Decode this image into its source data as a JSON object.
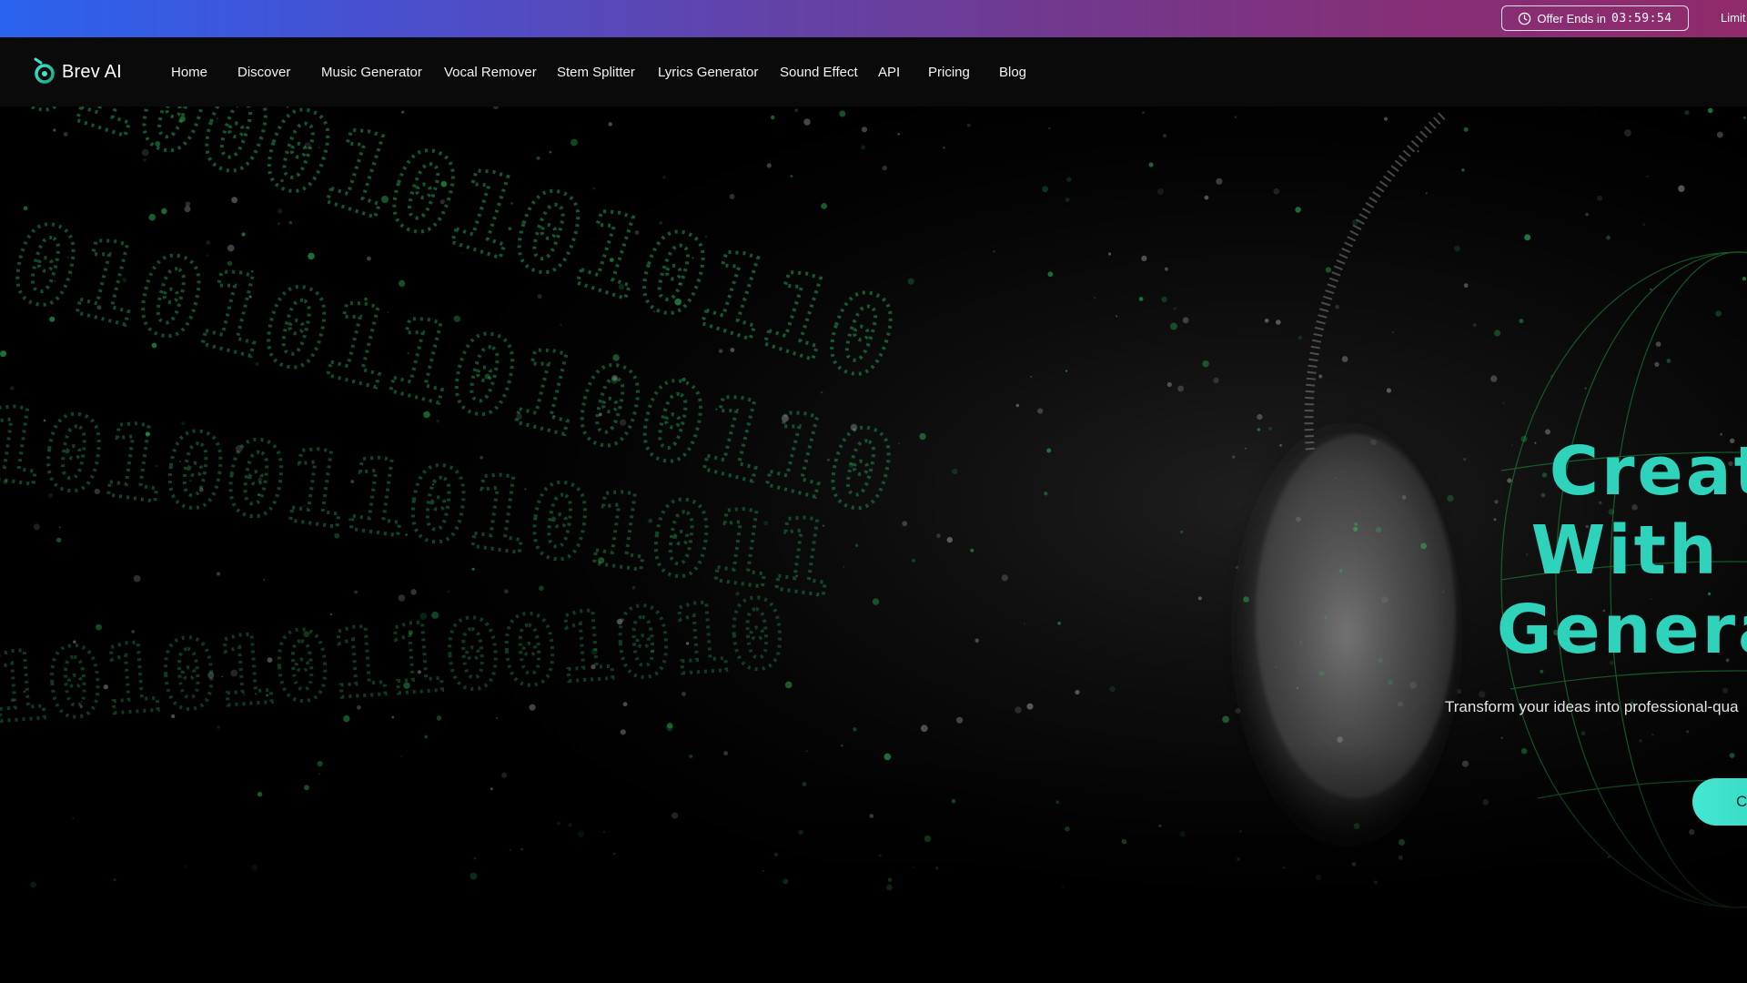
{
  "promo": {
    "offer_label": "Offer Ends in",
    "offer_timer": "03:59:54",
    "limited_text": "Limit"
  },
  "brand": {
    "name": "Brev AI",
    "accent": "#2fd3bb"
  },
  "nav": {
    "items": [
      {
        "label": "Home"
      },
      {
        "label": "Discover"
      },
      {
        "label": "Music Generator"
      },
      {
        "label": "Vocal Remover"
      },
      {
        "label": "Stem Splitter"
      },
      {
        "label": "Lyrics Generator"
      },
      {
        "label": "Sound Effect"
      },
      {
        "label": "API"
      },
      {
        "label": "Pricing"
      },
      {
        "label": "Blog"
      }
    ]
  },
  "hero": {
    "title_line1": "Create",
    "title_line2": "With Br",
    "title_line3": "Generato",
    "subtitle": "Transform your ideas into professional-qua",
    "cta_label": "C",
    "background_text": "0100010101011010011010101100101000011101001101001"
  }
}
